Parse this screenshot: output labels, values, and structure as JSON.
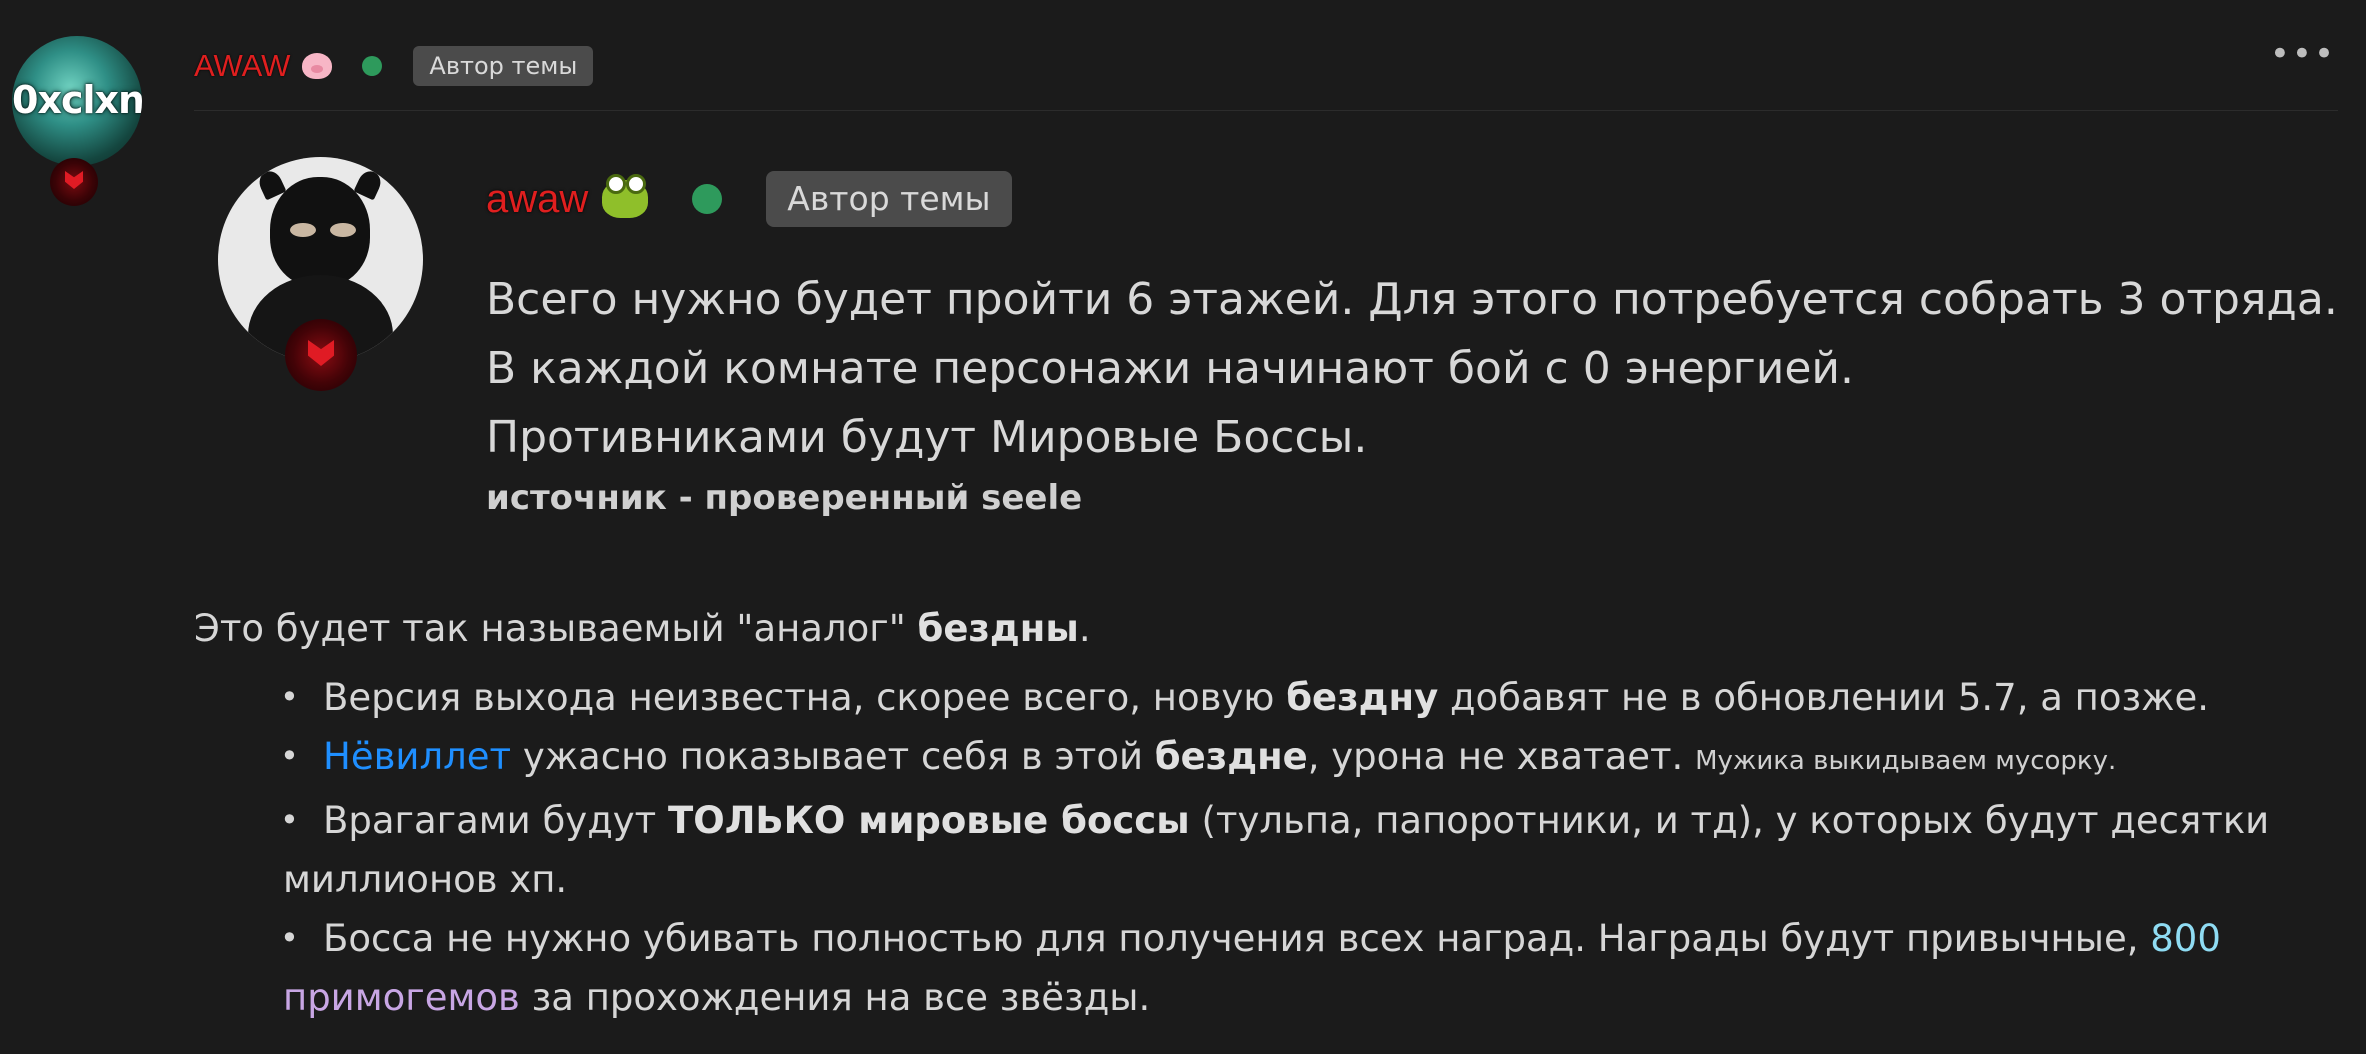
{
  "post": {
    "author": {
      "name": "AWAW",
      "emoji_icon": "pig-face-icon",
      "avatar_text": "0xclxn",
      "badge": "Автор темы",
      "status_color": "#2e9a5c"
    },
    "menu_icon": "more-horizontal-icon",
    "quote": {
      "author": "awaw",
      "emoji_icon": "frog-face-icon",
      "badge": "Автор темы",
      "lines": [
        "Всего нужно будет пройти 6 этажей. Для этого потребуется собрать 3 отряда.",
        "В каждой комнате персонажи начинают бой с 0 энергией.",
        "Противниками будут Мировые Боссы."
      ],
      "source": "источник - проверенный seele"
    },
    "intro": {
      "before": "Это будет так называемый \"аналог\" ",
      "bold": "бездны",
      "after": "."
    },
    "bullets": [
      {
        "p1": "Версия выхода неизвестна, скорее всего, новую ",
        "b1": "бездну",
        "p2": " добавят не в обновлении 5.7, а позже."
      },
      {
        "link": "Нёвиллет",
        "p1": " ужасно показывает себя в этой ",
        "b1": "бездне",
        "p2": ", урона не хватает. ",
        "small": "Мужика выкидываем мусорку."
      },
      {
        "p1": "Врагагами будут ",
        "b1": "ТОЛЬКО мировые боссы",
        "p2": " (тульпа, папоротники, и тд), у которых будут десятки",
        "p3": "миллионов хп."
      },
      {
        "p1": "Босса не нужно убивать полностью для получения всех наград. Награды будут привычные, ",
        "link1": "800",
        "link2": "примогемов",
        "p2": " за прохождения на все звёзды."
      }
    ],
    "colors": {
      "username": "#e01f1f",
      "link_blue": "#1f8fff",
      "link_cyan": "#8fdcf3",
      "link_lilac": "#c8a6e4",
      "background": "#1b1b1b"
    }
  }
}
